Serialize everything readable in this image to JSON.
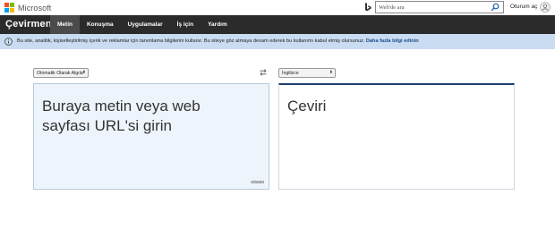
{
  "microsoft_bar": {
    "brand": "Microsoft",
    "logo_colors": [
      "#f25022",
      "#7fba00",
      "#00a4ef",
      "#ffb900"
    ],
    "search": {
      "value": "Web'de ara",
      "icon": "search-icon"
    },
    "bing_icon": "bing-icon",
    "signin_label": "Oturum aç",
    "avatar_icon": "person-icon"
  },
  "nav": {
    "brand": "Çevirmen",
    "items": [
      {
        "label": "Metin",
        "active": true
      },
      {
        "label": "Konuşma",
        "active": false
      },
      {
        "label": "Uygulamalar",
        "active": false
      },
      {
        "label": "İş için",
        "active": false
      },
      {
        "label": "Yardım",
        "active": false
      }
    ]
  },
  "banner": {
    "text": "Bu site, analitik, kişiselleştirilmiş içerik ve reklamlar için tanımlama bilgilerini kullanır. Bu siteye göz atmaya devam ederek bu kullanımı kabul etmiş olursunuz.",
    "link": "Daha fazla bilgi edinin",
    "icon": "info-icon"
  },
  "translator": {
    "source_language": "Otomatik Olarak Algıla",
    "target_language": "İngilizce",
    "swap_icon": "swap-icon",
    "source_placeholder": "Buraya metin veya web sayfası URL'si girin",
    "char_count": "0/5000",
    "target_placeholder": "Çeviri"
  },
  "colors": {
    "nav_bg": "#2b2b2b",
    "banner_bg": "#c9dcf1",
    "source_bg": "#eef4fb",
    "target_accent": "#1c3f6e"
  }
}
